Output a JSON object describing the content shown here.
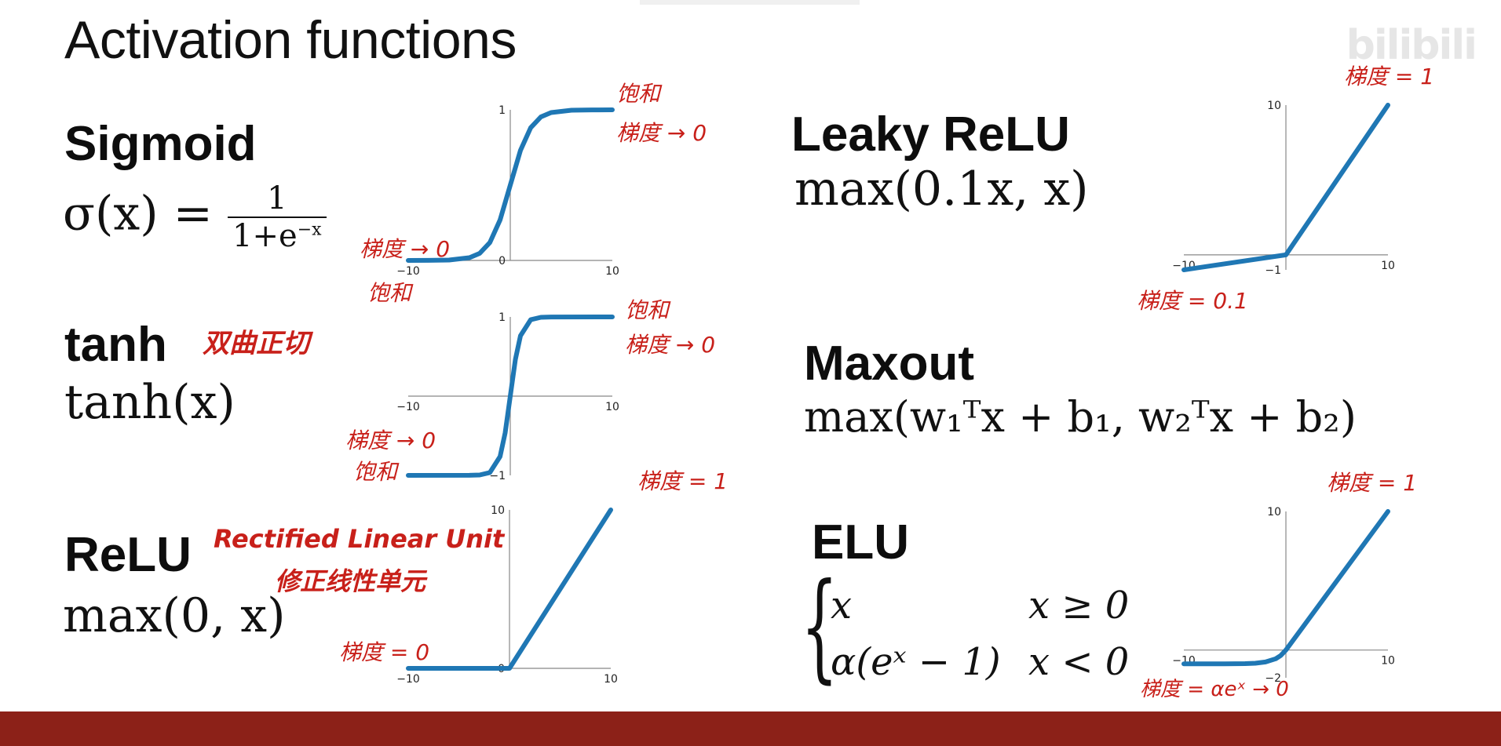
{
  "title": "Activation functions",
  "watermark": "bilibili",
  "colors": {
    "curve": "#1f77b4",
    "annotation": "#c8201a",
    "footer": "#8c2118"
  },
  "sigmoid": {
    "name": "Sigmoid",
    "formula_lhs": "σ(x) =",
    "formula_num": "1",
    "formula_den": "1+e",
    "formula_den_exp": "−x",
    "notes": {
      "top_saturation": "饱和",
      "top_gradient": "梯度 → 0",
      "bottom_gradient": "梯度 → 0",
      "bottom_saturation": "饱和"
    }
  },
  "tanh": {
    "name": "tanh",
    "formula": "tanh(x)",
    "name_note": "双曲正切",
    "notes": {
      "top_saturation": "饱和",
      "top_gradient": "梯度 → 0",
      "bottom_gradient": "梯度 → 0",
      "bottom_saturation": "饱和"
    }
  },
  "relu": {
    "name": "ReLU",
    "formula": "max(0, x)",
    "note_en": "Rectified Linear Unit",
    "note_zh": "修正线性单元",
    "notes": {
      "right_gradient": "梯度 = 1",
      "left_gradient": "梯度 = 0"
    }
  },
  "leaky_relu": {
    "name": "Leaky ReLU",
    "formula": "max(0.1x, x)",
    "notes": {
      "right_gradient": "梯度 = 1",
      "left_gradient": "梯度 = 0.1"
    }
  },
  "maxout": {
    "name": "Maxout",
    "formula": "max(w₁ᵀx + b₁, w₂ᵀx + b₂)"
  },
  "elu": {
    "name": "ELU",
    "case1_expr": "x",
    "case1_cond": "x ≥ 0",
    "case2_expr": "α(eˣ − 1)",
    "case2_cond": "x < 0",
    "notes": {
      "right_gradient": "梯度 = 1",
      "left_gradient": "梯度 = αeˣ → 0"
    }
  },
  "chart_data": [
    {
      "name": "sigmoid-chart",
      "type": "line",
      "function": "sigmoid",
      "xlim": [
        -10,
        10
      ],
      "ylim": [
        0,
        1
      ],
      "xticks": [
        "−10",
        "10"
      ],
      "yticks": [
        "0",
        "1"
      ],
      "x": [
        -10,
        -8,
        -6,
        -4,
        -3,
        -2,
        -1,
        0,
        1,
        2,
        3,
        4,
        6,
        8,
        10
      ],
      "y": [
        0.0,
        0.0003,
        0.0025,
        0.018,
        0.047,
        0.119,
        0.269,
        0.5,
        0.731,
        0.881,
        0.953,
        0.982,
        0.9975,
        0.9997,
        1.0
      ]
    },
    {
      "name": "tanh-chart",
      "type": "line",
      "function": "tanh",
      "xlim": [
        -10,
        10
      ],
      "ylim": [
        -1,
        1
      ],
      "xticks": [
        "−10",
        "10"
      ],
      "yticks": [
        "−1",
        "1"
      ],
      "x": [
        -10,
        -4,
        -3,
        -2,
        -1,
        -0.5,
        0,
        0.5,
        1,
        2,
        3,
        4,
        10
      ],
      "y": [
        -1.0,
        -0.999,
        -0.995,
        -0.964,
        -0.762,
        -0.462,
        0.0,
        0.462,
        0.762,
        0.964,
        0.995,
        0.999,
        1.0
      ]
    },
    {
      "name": "relu-chart",
      "type": "line",
      "function": "relu",
      "xlim": [
        -10,
        10
      ],
      "ylim": [
        0,
        10
      ],
      "xticks": [
        "−10",
        "10"
      ],
      "yticks": [
        "0",
        "10"
      ],
      "x": [
        -10,
        0,
        10
      ],
      "y": [
        0,
        0,
        10
      ]
    },
    {
      "name": "leaky-relu-chart",
      "type": "line",
      "function": "leaky_relu",
      "xlim": [
        -10,
        10
      ],
      "ylim": [
        -1,
        10
      ],
      "xticks": [
        "−10",
        "10"
      ],
      "yticks": [
        "−1",
        "10"
      ],
      "x": [
        -10,
        0,
        10
      ],
      "y": [
        -1,
        0,
        10
      ]
    },
    {
      "name": "elu-chart",
      "type": "line",
      "function": "elu",
      "xlim": [
        -10,
        10
      ],
      "ylim": [
        -2,
        10
      ],
      "xticks": [
        "−10",
        "10"
      ],
      "yticks": [
        "−2",
        "10"
      ],
      "x": [
        -10,
        -6,
        -4,
        -3,
        -2,
        -1,
        -0.5,
        0,
        10
      ],
      "y": [
        -1.0,
        -0.998,
        -0.982,
        -0.95,
        -0.865,
        -0.632,
        -0.393,
        0,
        10
      ]
    }
  ]
}
